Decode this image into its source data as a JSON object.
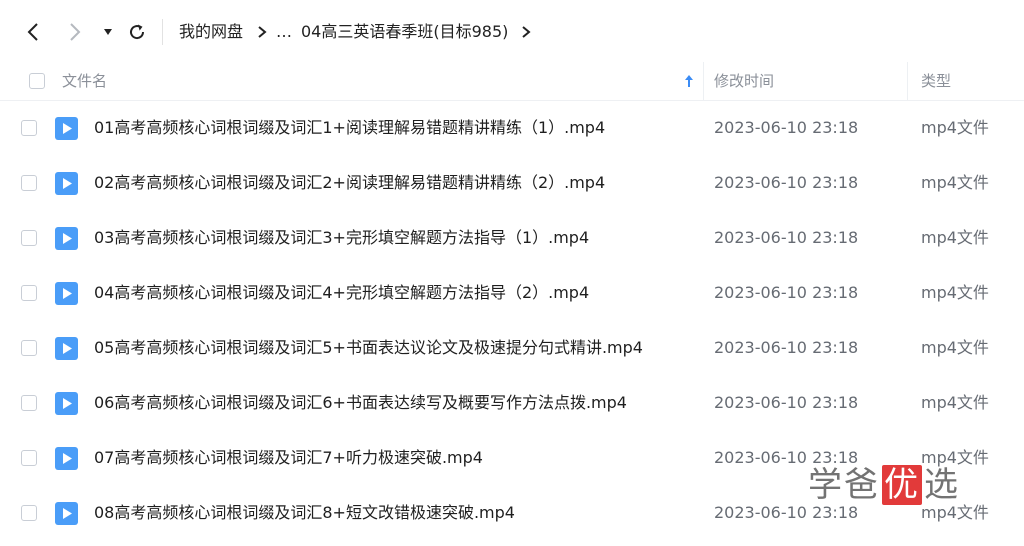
{
  "toolbar": {
    "back_icon": "chevron-left-icon",
    "forward_icon": "chevron-right-icon",
    "dropdown_icon": "caret-down-icon",
    "refresh_icon": "refresh-icon"
  },
  "breadcrumb": {
    "root": "我的网盘",
    "ellipsis": "…",
    "current": "04高三英语春季班(目标985)"
  },
  "columns": {
    "name": "文件名",
    "modified": "修改时间",
    "type": "类型"
  },
  "files": [
    {
      "name": "01高考高频核心词根词缀及词汇1+阅读理解易错题精讲精练（1）.mp4",
      "modified": "2023-06-10 23:18",
      "type": "mp4文件"
    },
    {
      "name": "02高考高频核心词根词缀及词汇2+阅读理解易错题精讲精练（2）.mp4",
      "modified": "2023-06-10 23:18",
      "type": "mp4文件"
    },
    {
      "name": "03高考高频核心词根词缀及词汇3+完形填空解题方法指导（1）.mp4",
      "modified": "2023-06-10 23:18",
      "type": "mp4文件"
    },
    {
      "name": "04高考高频核心词根词缀及词汇4+完形填空解题方法指导（2）.mp4",
      "modified": "2023-06-10 23:18",
      "type": "mp4文件"
    },
    {
      "name": "05高考高频核心词根词缀及词汇5+书面表达议论文及极速提分句式精讲.mp4",
      "modified": "2023-06-10 23:18",
      "type": "mp4文件"
    },
    {
      "name": "06高考高频核心词根词缀及词汇6+书面表达续写及概要写作方法点拨.mp4",
      "modified": "2023-06-10 23:18",
      "type": "mp4文件"
    },
    {
      "name": "07高考高频核心词根词缀及词汇7+听力极速突破.mp4",
      "modified": "2023-06-10 23:18",
      "type": "mp4文件"
    },
    {
      "name": "08高考高频核心词根词缀及词汇8+短文改错极速突破.mp4",
      "modified": "2023-06-10 23:18",
      "type": "mp4文件"
    }
  ],
  "watermark": {
    "part1": "学爸",
    "part2": "优",
    "part3": "选"
  },
  "colors": {
    "file_icon": "#4a9df8",
    "sort_arrow": "#3b8cf5",
    "watermark_red": "#e23a3a"
  }
}
